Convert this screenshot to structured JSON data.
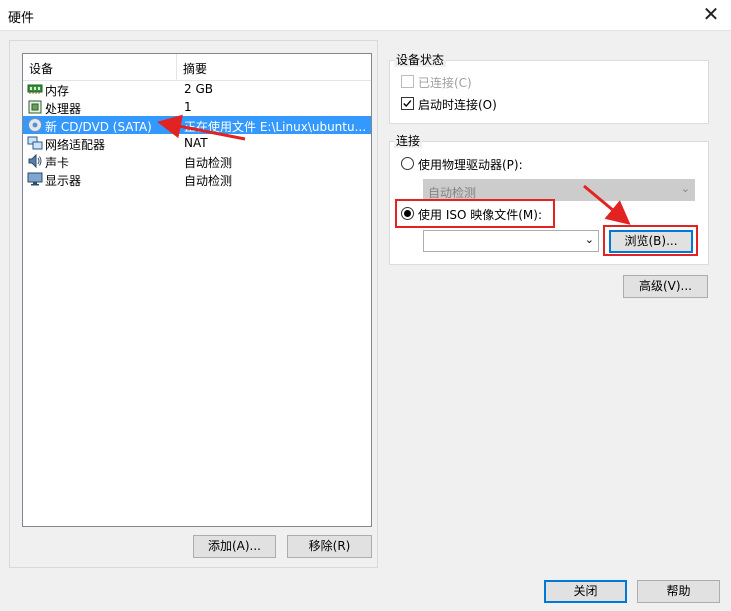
{
  "window": {
    "title": "硬件",
    "close_label": "✕"
  },
  "device_list": {
    "headers": {
      "device": "设备",
      "summary": "摘要"
    },
    "items": [
      {
        "name": "内存",
        "summary": "2 GB",
        "icon": "memory-icon"
      },
      {
        "name": "处理器",
        "summary": "1",
        "icon": "processor-icon"
      },
      {
        "name": "新 CD/DVD (SATA)",
        "summary": "正在使用文件 E:\\Linux\\ubuntu...",
        "icon": "cd-dvd-icon",
        "selected": true
      },
      {
        "name": "网络适配器",
        "summary": "NAT",
        "icon": "network-adapter-icon"
      },
      {
        "name": "声卡",
        "summary": "自动检测",
        "icon": "sound-card-icon"
      },
      {
        "name": "显示器",
        "summary": "自动检测",
        "icon": "display-icon"
      }
    ]
  },
  "buttons": {
    "add": "添加(A)...",
    "remove": "移除(R)",
    "browse": "浏览(B)...",
    "advanced": "高级(V)...",
    "close": "关闭",
    "help": "帮助"
  },
  "device_status": {
    "title": "设备状态",
    "connected": {
      "label": "已连接(C)",
      "checked": false,
      "disabled": true
    },
    "connect_at_power_on": {
      "label": "启动时连接(O)",
      "checked": true
    }
  },
  "connection": {
    "title": "连接",
    "physical_drive": {
      "label": "使用物理驱动器(P):",
      "selected": false
    },
    "physical_drive_value": "自动检测",
    "iso_image": {
      "label": "使用 ISO 映像文件(M):",
      "selected": true
    },
    "iso_path_value": ""
  },
  "colors": {
    "selection": "#3399ff",
    "highlight": "#e32222",
    "accent": "#0078d7"
  }
}
